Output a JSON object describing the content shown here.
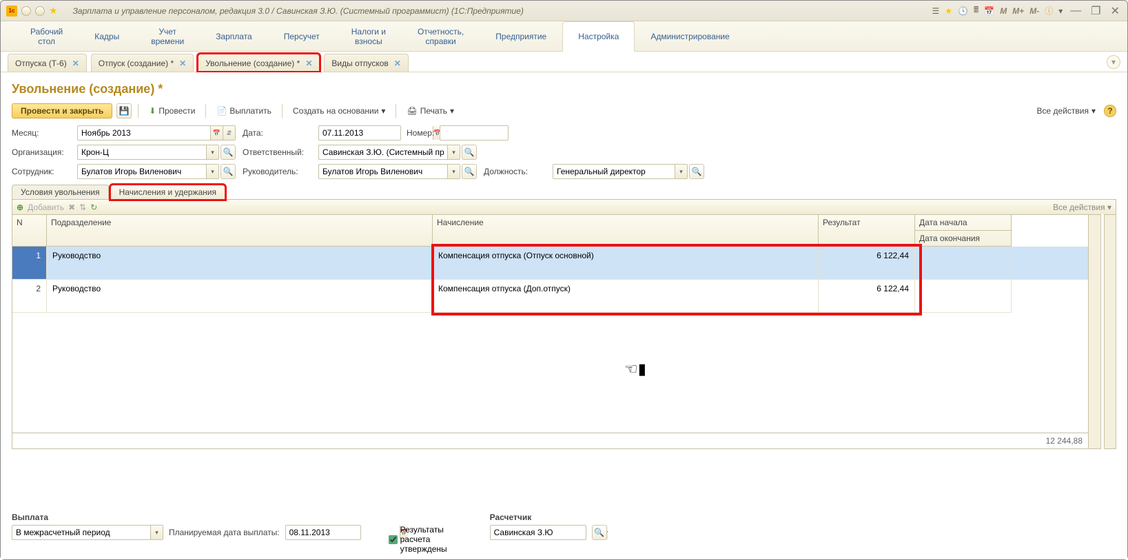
{
  "titlebar": {
    "title": "Зарплата и управление персоналом, редакция 3.0 / Савинская З.Ю. (Системный программист)  (1С:Предприятие)",
    "m_buttons": [
      "M",
      "M+",
      "M-"
    ]
  },
  "top_tabs": [
    {
      "l1": "Рабочий",
      "l2": "стол"
    },
    {
      "l1": "Кадры",
      "l2": ""
    },
    {
      "l1": "Учет",
      "l2": "времени"
    },
    {
      "l1": "Зарплата",
      "l2": ""
    },
    {
      "l1": "Персучет",
      "l2": ""
    },
    {
      "l1": "Налоги и",
      "l2": "взносы"
    },
    {
      "l1": "Отчетность,",
      "l2": "справки"
    },
    {
      "l1": "Предприятие",
      "l2": ""
    },
    {
      "l1": "Настройка",
      "l2": ""
    },
    {
      "l1": "Администрирование",
      "l2": ""
    }
  ],
  "doc_tabs": [
    {
      "label": "Отпуска (Т-6)"
    },
    {
      "label": "Отпуск (создание) *"
    },
    {
      "label": "Увольнение (создание) *",
      "highlight": true
    },
    {
      "label": "Виды отпусков"
    }
  ],
  "page_title": "Увольнение (создание) *",
  "toolbar": {
    "primary": "Провести и закрыть",
    "provesti": "Провести",
    "vyplatit": "Выплатить",
    "sozdat": "Создать на основании",
    "pechat": "Печать",
    "all_actions": "Все действия"
  },
  "form": {
    "month_label": "Месяц:",
    "month_value": "Ноябрь 2013",
    "date_label": "Дата:",
    "date_value": "07.11.2013",
    "number_label": "Номер:",
    "number_value": "",
    "org_label": "Организация:",
    "org_value": "Крон-Ц",
    "resp_label": "Ответственный:",
    "resp_value": "Савинская З.Ю. (Системный про",
    "employee_label": "Сотрудник:",
    "employee_value": "Булатов Игорь Виленович",
    "manager_label": "Руководитель:",
    "manager_value": "Булатов Игорь Виленович",
    "position_label": "Должность:",
    "position_value": "Генеральный директор"
  },
  "inner_tabs": {
    "tab1": "Условия увольнения",
    "tab2": "Начисления и удержания"
  },
  "panel_toolbar": {
    "add": "Добавить",
    "all": "Все действия"
  },
  "table": {
    "col_n": "N",
    "col_dept": "Подразделение",
    "col_charge": "Начисление",
    "col_result": "Результат",
    "col_date1": "Дата начала",
    "col_date2": "Дата окончания",
    "rows": [
      {
        "n": "1",
        "dept": "Руководство",
        "charge": "Компенсация отпуска (Отпуск основной)",
        "result": "6 122,44"
      },
      {
        "n": "2",
        "dept": "Руководство",
        "charge": "Компенсация отпуска (Доп.отпуск)",
        "result": "6 122,44"
      }
    ],
    "total": "12 244,88"
  },
  "bottom": {
    "pay_header": "Выплата",
    "pay_value": "В межрасчетный период",
    "plan_label": "Планируемая дата выплаты:",
    "plan_value": "08.11.2013",
    "chk_label": "Результаты расчета утверждены",
    "calc_header": "Расчетчик",
    "calc_value": "Савинская З.Ю"
  }
}
